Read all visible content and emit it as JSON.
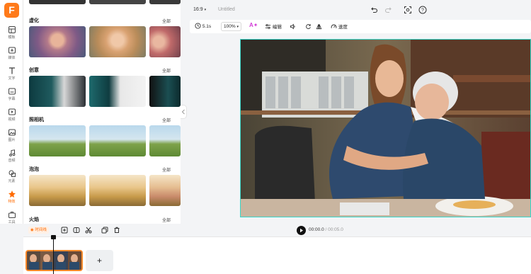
{
  "brand": {
    "logo_letter": "F",
    "accent": "#ff7a1a"
  },
  "rail": {
    "items": [
      {
        "label": "模板",
        "icon": "template-icon"
      },
      {
        "label": "媒体",
        "icon": "media-icon"
      },
      {
        "label": "文字",
        "icon": "text-icon"
      },
      {
        "label": "字幕",
        "icon": "subtitle-icon"
      },
      {
        "label": "视频",
        "icon": "video-icon"
      },
      {
        "label": "图片",
        "icon": "image-icon"
      },
      {
        "label": "音频",
        "icon": "audio-icon"
      },
      {
        "label": "元素",
        "icon": "elements-icon"
      },
      {
        "label": "特效",
        "icon": "effects-icon",
        "active": true
      },
      {
        "label": "工具",
        "icon": "tools-icon"
      }
    ]
  },
  "panel": {
    "categories": [
      {
        "title": "虚化",
        "all": "全部"
      },
      {
        "title": "创意",
        "all": "全部"
      },
      {
        "title": "照相机",
        "all": "全部"
      },
      {
        "title": "泡泡",
        "all": "全部"
      },
      {
        "title": "火焰",
        "all": "全部"
      }
    ]
  },
  "topbar": {
    "aspect": "16:9",
    "project_name": "Untitled",
    "icons": [
      "undo-icon",
      "redo-icon",
      "screen-record-icon",
      "help-icon"
    ]
  },
  "toolbar": {
    "duration": "5.1s",
    "zoom": "100%",
    "edit_label": "编辑",
    "speed_label": "速度",
    "icons": [
      "clock-icon",
      "ai-magic-icon",
      "edit-sliders-icon",
      "volume-icon",
      "rotate-icon",
      "flip-icon",
      "speed-icon"
    ]
  },
  "controls": {
    "timeline_badge": "时间线",
    "current_time": "00:00.0",
    "separator": "/",
    "total_time": "00:05.0",
    "icons": [
      "add-icon",
      "split-icon",
      "cut-icon",
      "duplicate-icon",
      "delete-icon",
      "play-icon"
    ]
  },
  "timeline": {
    "add_label": "+"
  }
}
